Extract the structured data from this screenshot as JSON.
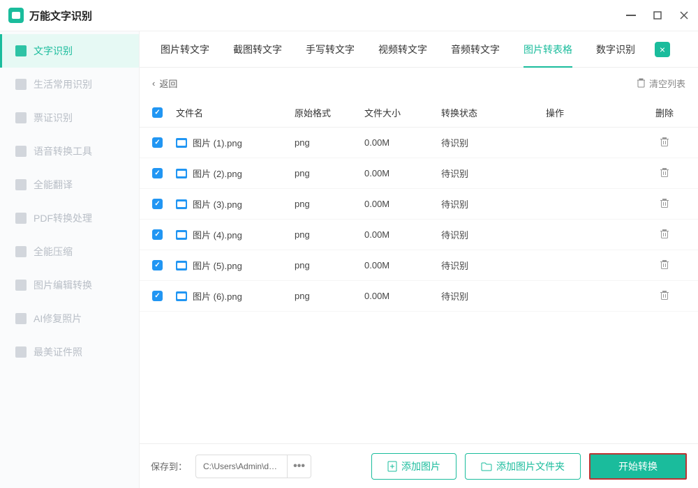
{
  "app": {
    "title": "万能文字识别"
  },
  "sidebar": {
    "items": [
      {
        "label": "文字识别"
      },
      {
        "label": "生活常用识别"
      },
      {
        "label": "票证识别"
      },
      {
        "label": "语音转换工具"
      },
      {
        "label": "全能翻译"
      },
      {
        "label": "PDF转换处理"
      },
      {
        "label": "全能压缩"
      },
      {
        "label": "图片编辑转换"
      },
      {
        "label": "AI修复照片"
      },
      {
        "label": "最美证件照"
      }
    ]
  },
  "tabs": {
    "items": [
      {
        "label": "图片转文字"
      },
      {
        "label": "截图转文字"
      },
      {
        "label": "手写转文字"
      },
      {
        "label": "视频转文字"
      },
      {
        "label": "音频转文字"
      },
      {
        "label": "图片转表格"
      },
      {
        "label": "数字识别"
      }
    ],
    "active_index": 5
  },
  "toolbar": {
    "back": "返回",
    "clear": "清空列表"
  },
  "columns": {
    "filename": "文件名",
    "format": "原始格式",
    "size": "文件大小",
    "status": "转换状态",
    "ops": "操作",
    "del": "删除"
  },
  "files": [
    {
      "name": "图片 (1).png",
      "fmt": "png",
      "size": "0.00M",
      "status": "待识别"
    },
    {
      "name": "图片 (2).png",
      "fmt": "png",
      "size": "0.00M",
      "status": "待识别"
    },
    {
      "name": "图片 (3).png",
      "fmt": "png",
      "size": "0.00M",
      "status": "待识别"
    },
    {
      "name": "图片 (4).png",
      "fmt": "png",
      "size": "0.00M",
      "status": "待识别"
    },
    {
      "name": "图片 (5).png",
      "fmt": "png",
      "size": "0.00M",
      "status": "待识别"
    },
    {
      "name": "图片 (6).png",
      "fmt": "png",
      "size": "0.00M",
      "status": "待识别"
    }
  ],
  "footer": {
    "save_label": "保存到：",
    "path": "C:\\Users\\Admin\\deskt...",
    "more": "•••",
    "add_image": "添加图片",
    "add_folder": "添加图片文件夹",
    "start": "开始转换"
  }
}
